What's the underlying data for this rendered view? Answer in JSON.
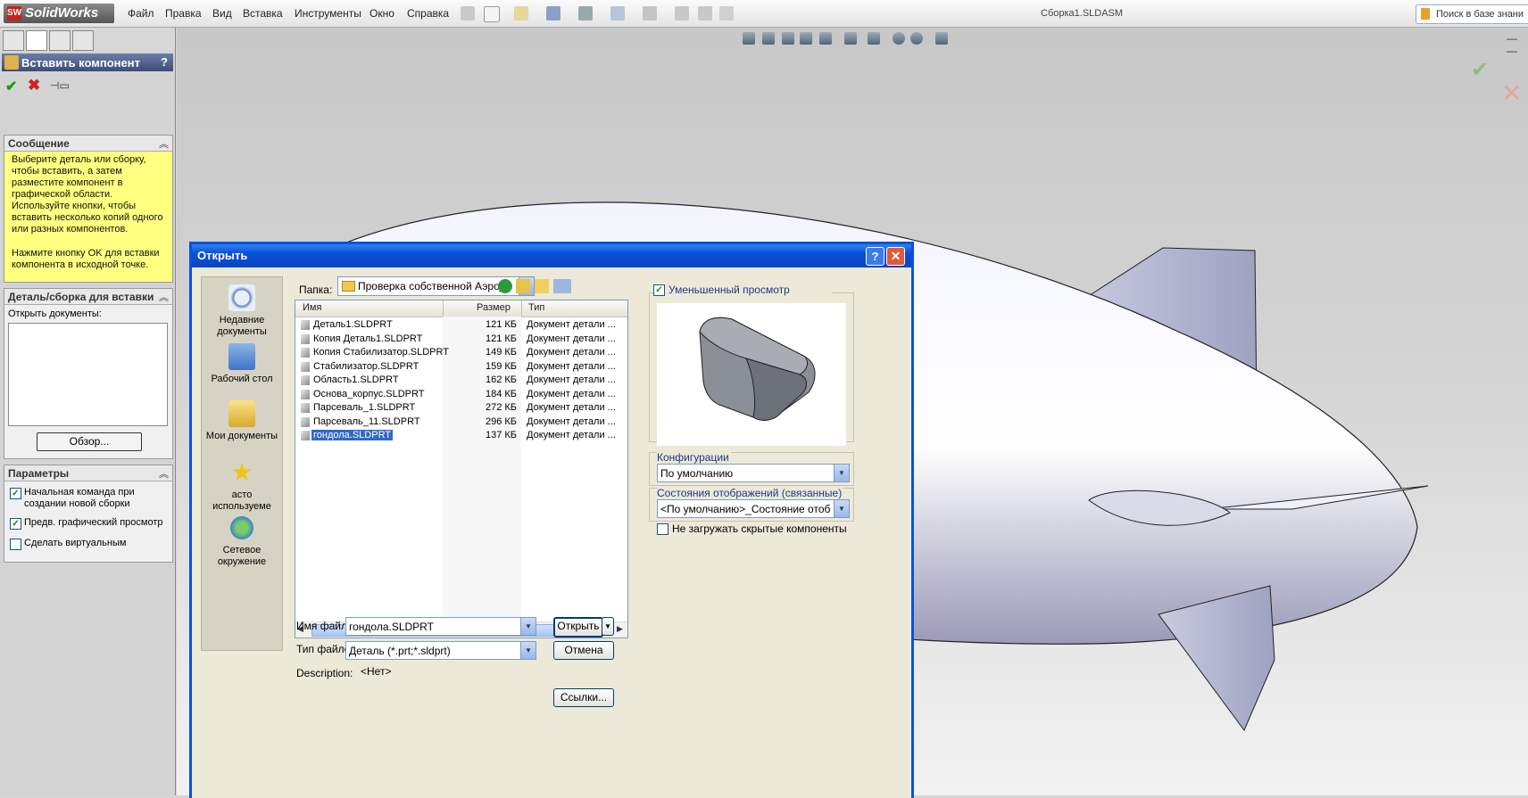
{
  "app": {
    "logo_text": "SolidWorks",
    "menu": [
      "Файл",
      "Правка",
      "Вид",
      "Вставка",
      "Инструменты",
      "Окно",
      "Справка"
    ],
    "document_title": "Сборка1.SLDASM",
    "search_placeholder": "Поиск в базе знани"
  },
  "property_manager": {
    "title": "Вставить компонент",
    "help": "?",
    "ok_icon": "✔",
    "cancel_icon": "✖",
    "pin_icon": "📌",
    "message": {
      "header": "Сообщение",
      "text1": "Выберите деталь или сборку, чтобы вставить, а затем разместите компонент в графической области. Используйте кнопки, чтобы вставить несколько копий одного или разных компонентов.",
      "text2": "Нажмите кнопку OK для вставки компонента в исходной точке."
    },
    "part_group": {
      "header": "Деталь/сборка для вставки",
      "open_docs_label": "Открыть документы:",
      "browse_button": "Обзор..."
    },
    "params": {
      "header": "Параметры",
      "items": [
        {
          "label": "Начальная команда при создании новой сборки",
          "checked": true
        },
        {
          "label": "Предв. графический просмотр",
          "checked": true
        },
        {
          "label": "Сделать виртуальным",
          "checked": false
        }
      ]
    }
  },
  "dialog": {
    "title": "Открыть",
    "help": "?",
    "close": "✕",
    "places": [
      {
        "label": "Недавние документы",
        "icon": "recent-icon"
      },
      {
        "label": "Рабочий стол",
        "icon": "desktop-icon"
      },
      {
        "label": "Мои документы",
        "icon": "my-documents-icon"
      },
      {
        "label": "асто используеме",
        "icon": "favorites-icon"
      },
      {
        "label": "Сетевое окружение",
        "icon": "network-icon"
      }
    ],
    "lookin_label": "Папка:",
    "lookin_value": "Проверка собственной Аэродин пр",
    "columns": {
      "name": "Имя",
      "size": "Размер",
      "type": "Тип"
    },
    "files": [
      {
        "name": "Деталь1.SLDPRT",
        "size": "121 КБ",
        "type": "Документ детали ..."
      },
      {
        "name": "Копия Деталь1.SLDPRT",
        "size": "121 КБ",
        "type": "Документ детали ..."
      },
      {
        "name": "Копия Стабилизатор.SLDPRT",
        "size": "149 КБ",
        "type": "Документ детали ..."
      },
      {
        "name": "Стабилизатор.SLDPRT",
        "size": "159 КБ",
        "type": "Документ детали ..."
      },
      {
        "name": "Область1.SLDPRT",
        "size": "162 КБ",
        "type": "Документ детали ..."
      },
      {
        "name": "Основа_корпус.SLDPRT",
        "size": "184 КБ",
        "type": "Документ детали ..."
      },
      {
        "name": "Парсеваль_1.SLDPRT",
        "size": "272 КБ",
        "type": "Документ детали ..."
      },
      {
        "name": "Парсеваль_11.SLDPRT",
        "size": "296 КБ",
        "type": "Документ детали ..."
      },
      {
        "name": "гондола.SLDPRT",
        "size": "137 КБ",
        "type": "Документ детали ...",
        "selected": true
      }
    ],
    "filename_label": "Имя файла:",
    "filename_value": "гондола.SLDPRT",
    "filetype_label": "Тип файлов:",
    "filetype_value": "Деталь (*.prt;*.sldprt)",
    "description_label": "Description:",
    "description_value": "<Нет>",
    "open_button": "Открыть",
    "cancel_button": "Отмена",
    "references_button": "Ссылки...",
    "thumbnail_label": "Уменьшенный просмотр",
    "thumbnail_checked": true,
    "config_label": "Конфигурации",
    "config_value": "По умолчанию",
    "display_states_label": "Состояния отображений (связанные)",
    "display_states_value": "<По умолчанию>_Состояние отображения",
    "hide_components_label": "Не загружать скрытые компоненты",
    "hide_components_checked": false
  },
  "colors": {
    "dialog_title": "#0a53d6",
    "selection": "#316ac5",
    "message_bg": "#ffff80"
  }
}
